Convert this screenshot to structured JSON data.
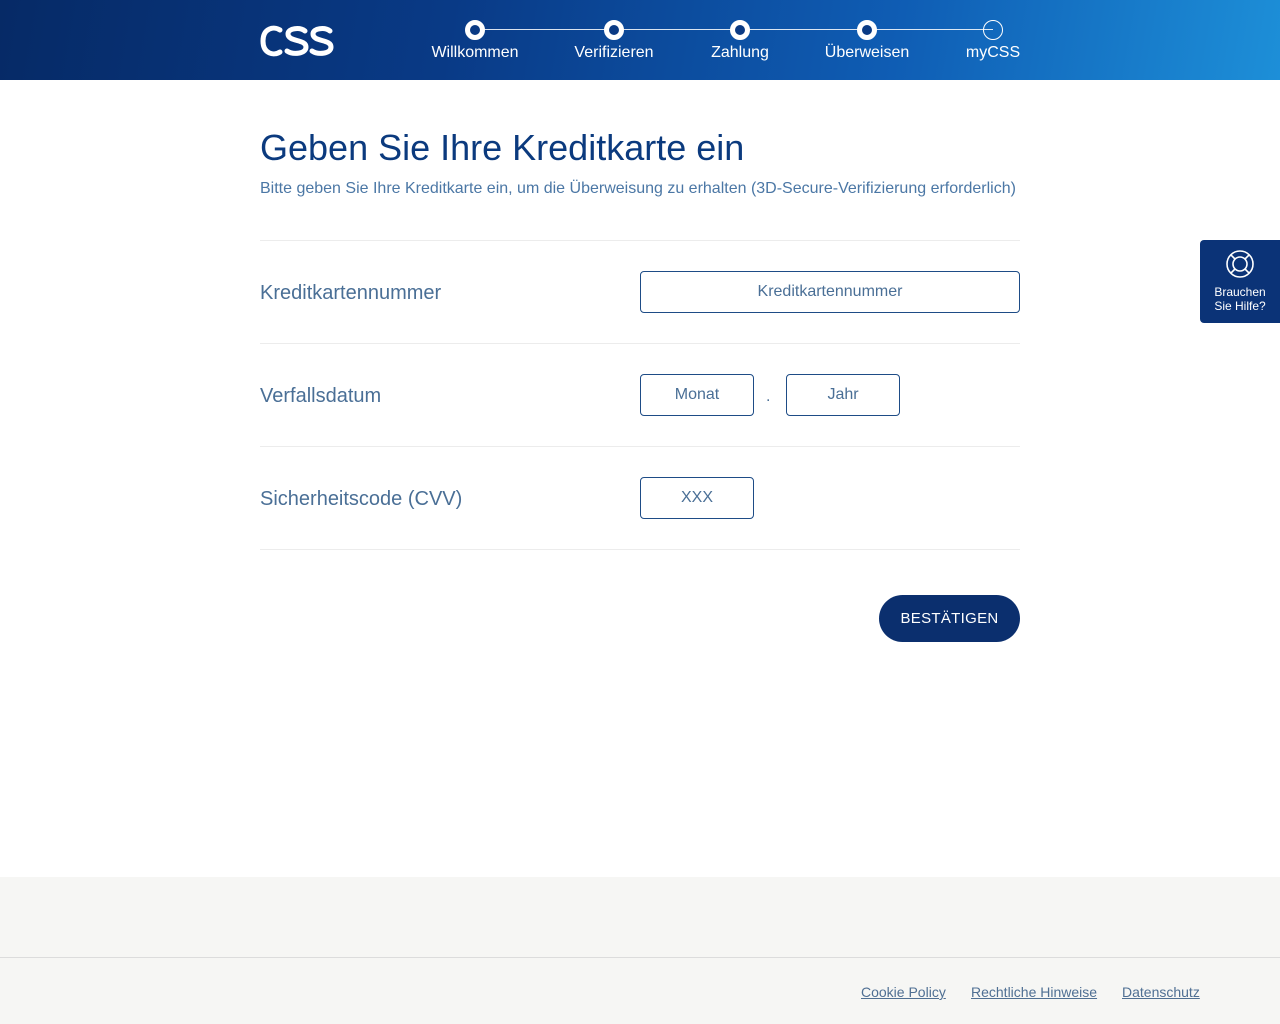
{
  "header": {
    "logo_text": "CSS",
    "steps": [
      {
        "label": "Willkommen",
        "status": "done"
      },
      {
        "label": "Verifizieren",
        "status": "done"
      },
      {
        "label": "Zahlung",
        "status": "done"
      },
      {
        "label": "Überweisen",
        "status": "done"
      },
      {
        "label": "myCSS",
        "status": "todo"
      }
    ]
  },
  "main": {
    "title": "Geben Sie Ihre Kreditkarte ein",
    "subtitle": "Bitte geben Sie Ihre Kreditkarte ein, um die Überweisung zu erhalten (3D-Secure-Verifizierung erforderlich)",
    "card_number": {
      "label": "Kreditkartennummer",
      "placeholder": "Kreditkartennummer",
      "value": ""
    },
    "expiry": {
      "label": "Verfallsdatum",
      "month_placeholder": "Monat",
      "year_placeholder": "Jahr",
      "separator": "."
    },
    "cvv": {
      "label": "Sicherheitscode (CVV)",
      "placeholder": "XXX"
    },
    "confirm_label": "BESTÄTIGEN"
  },
  "help": {
    "line1": "Brauchen",
    "line2": "Sie Hilfe?",
    "icon": "lifebuoy-icon"
  },
  "footer": {
    "links": [
      "Cookie Policy",
      "Rechtliche Hinweise",
      "Datenschutz"
    ]
  },
  "colors": {
    "primary": "#0b2f6e",
    "header_gradient_start": "#062a66",
    "header_gradient_end": "#1d8fd8",
    "text_muted": "#4a6f96"
  }
}
